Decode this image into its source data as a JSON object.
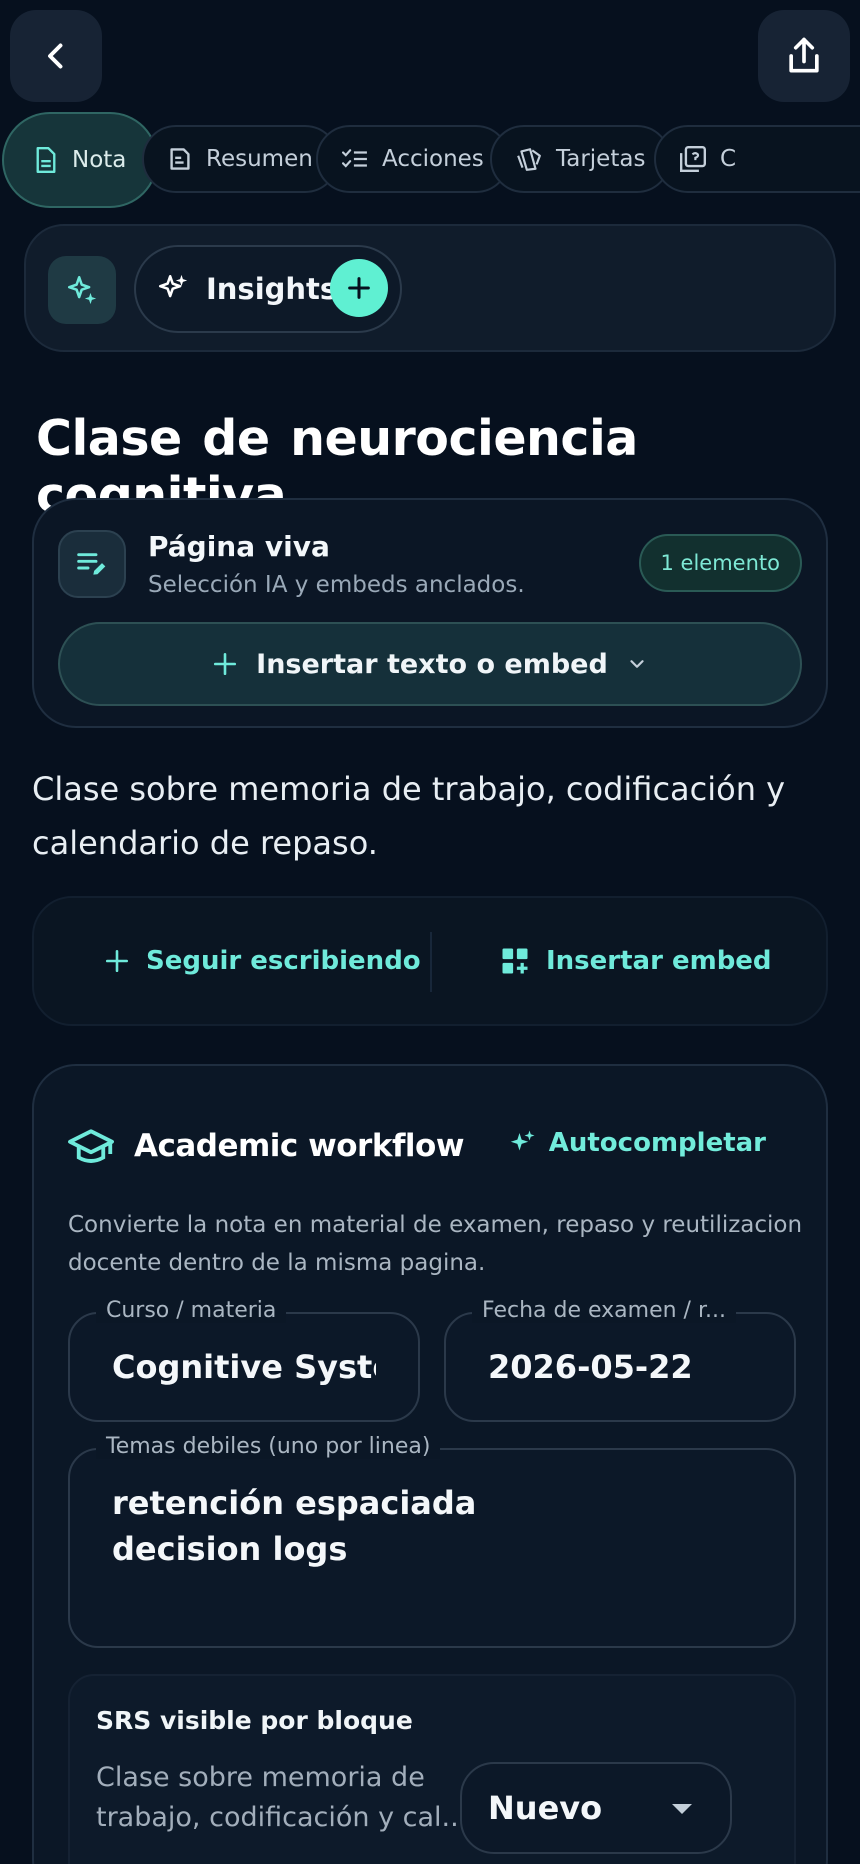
{
  "colors": {
    "background": "#06101e",
    "accent": "#5ff0d2",
    "accent_text": "#6feadb"
  },
  "header": {
    "back_icon": "chevron-left-icon",
    "share_icon": "share-icon"
  },
  "tabs": [
    {
      "label": "Nota",
      "icon": "document-icon",
      "active": true
    },
    {
      "label": "Resumen",
      "icon": "summary-icon",
      "active": false
    },
    {
      "label": "Acciones",
      "icon": "checklist-icon",
      "active": false
    },
    {
      "label": "Tarjetas",
      "icon": "cards-icon",
      "active": false
    },
    {
      "label": "C",
      "icon": "quiz-icon",
      "active": false
    }
  ],
  "insights": {
    "label": "Insights"
  },
  "page": {
    "title": "Clase de neurociencia cognitiva"
  },
  "live_page": {
    "title": "Página viva",
    "subtitle": "Selección IA y embeds anclados.",
    "badge": "1 elemento",
    "insert_label": "Insertar texto o embed"
  },
  "note_body": "Clase sobre memoria de trabajo, codificación y calendario de repaso.",
  "actions": {
    "continue_label": "Seguir escribiendo",
    "embed_label": "Insertar embed"
  },
  "workflow": {
    "title": "Academic workflow",
    "autocomplete_label": "Autocompletar",
    "description": "Convierte la nota en material de examen, repaso y reutilizacion docente dentro de la misma pagina.",
    "course": {
      "label": "Curso / materia",
      "value": "Cognitive System"
    },
    "exam_date": {
      "label": "Fecha de examen / r...",
      "value": "2026-05-22"
    },
    "weak_topics": {
      "label": "Temas debiles (uno por linea)",
      "line1": "retención espaciada",
      "line2": "decision logs"
    },
    "srs": {
      "title": "SRS visible por bloque",
      "text": "Clase sobre memoria de trabajo, codificación y cal...",
      "selected": "Nuevo"
    }
  }
}
